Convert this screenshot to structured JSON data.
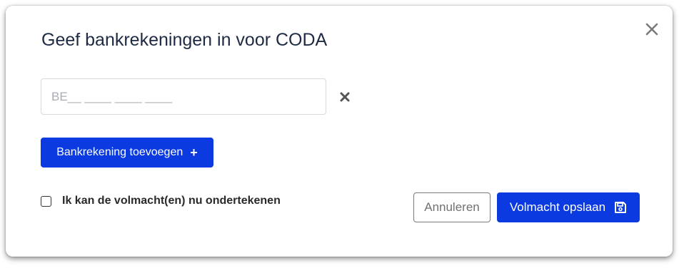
{
  "dialog": {
    "title": "Geef bankrekeningen in voor CODA",
    "close_icon": "close-icon"
  },
  "iban_field": {
    "placeholder": "BE__ ____ ____ ____",
    "value": "",
    "remove_icon": "remove-icon"
  },
  "add_button": {
    "label": "Bankrekening toevoegen",
    "icon": "plus-icon"
  },
  "sign_option": {
    "label": "Ik kan de volmacht(en) nu ondertekenen",
    "checked": false
  },
  "footer": {
    "cancel_label": "Annuleren",
    "save_label": "Volmacht opslaan",
    "save_icon": "save-icon"
  },
  "colors": {
    "primary": "#0b3be0",
    "title": "#1f2a44",
    "close": "#7a7a7a"
  }
}
